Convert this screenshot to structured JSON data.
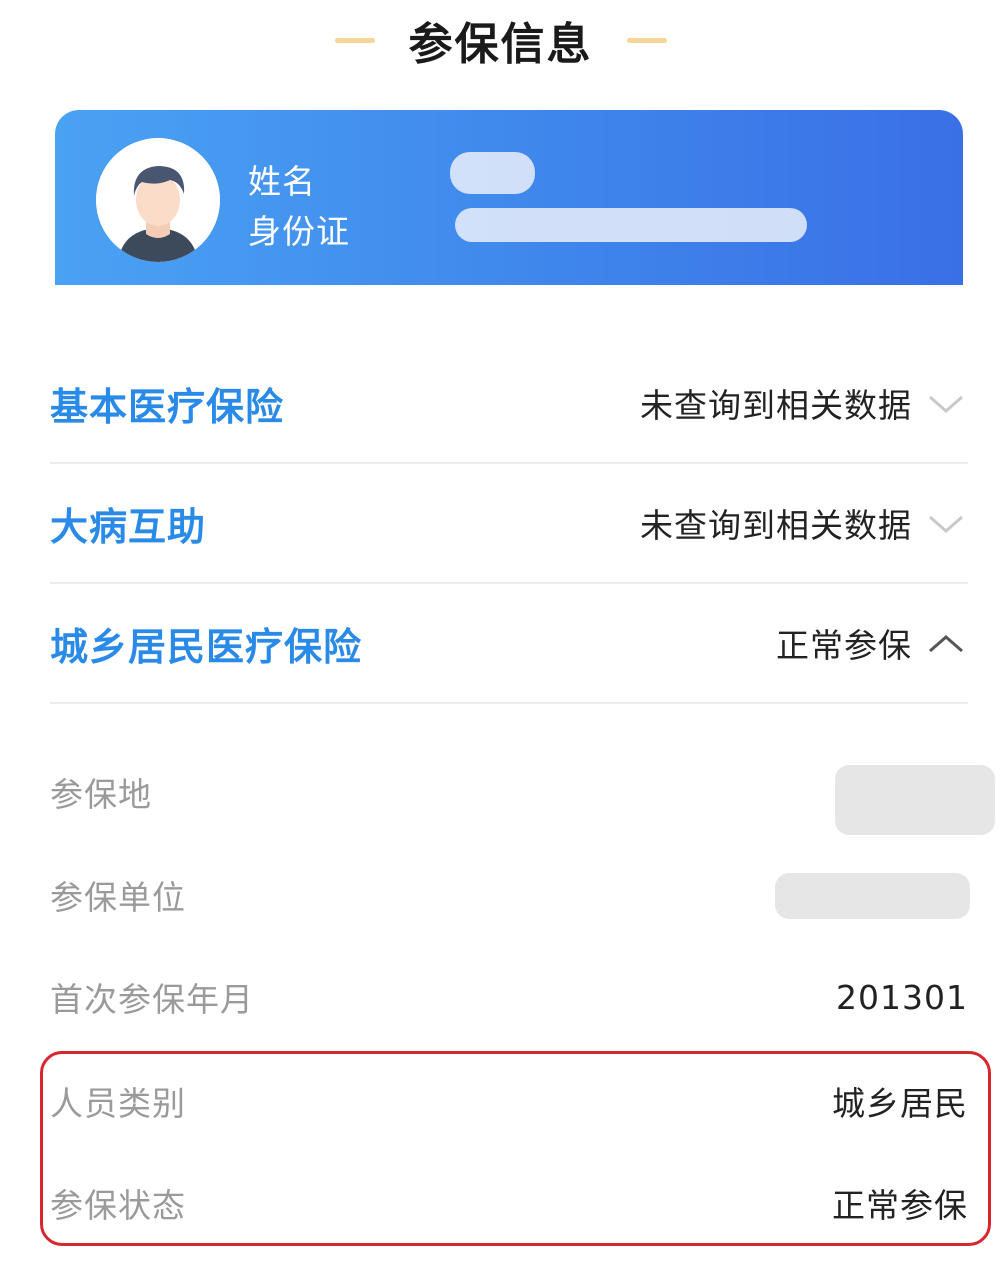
{
  "page": {
    "title": "参保信息"
  },
  "colors": {
    "accent_blue": "#2a8ae8",
    "card_gradient_start": "#4aa2f3",
    "card_gradient_end": "#3a70e6",
    "title_line": "#f5d59a",
    "highlight_red": "#d8262f"
  },
  "profile": {
    "name_label": "姓名",
    "id_label": "身份证",
    "avatar_icon": "user-avatar-icon"
  },
  "insurance": [
    {
      "title": "基本医疗保险",
      "status": "未查询到相关数据",
      "expanded": false,
      "chevron": "chevron-down-icon"
    },
    {
      "title": "大病互助",
      "status": "未查询到相关数据",
      "expanded": false,
      "chevron": "chevron-down-icon"
    },
    {
      "title": "城乡居民医疗保险",
      "status": "正常参保",
      "expanded": true,
      "chevron": "chevron-up-icon"
    }
  ],
  "details": [
    {
      "label": "参保地",
      "value": ""
    },
    {
      "label": "参保单位",
      "value": ""
    },
    {
      "label": "首次参保年月",
      "value": "201301"
    },
    {
      "label": "人员类别",
      "value": "城乡居民"
    },
    {
      "label": "参保状态",
      "value": "正常参保"
    }
  ]
}
